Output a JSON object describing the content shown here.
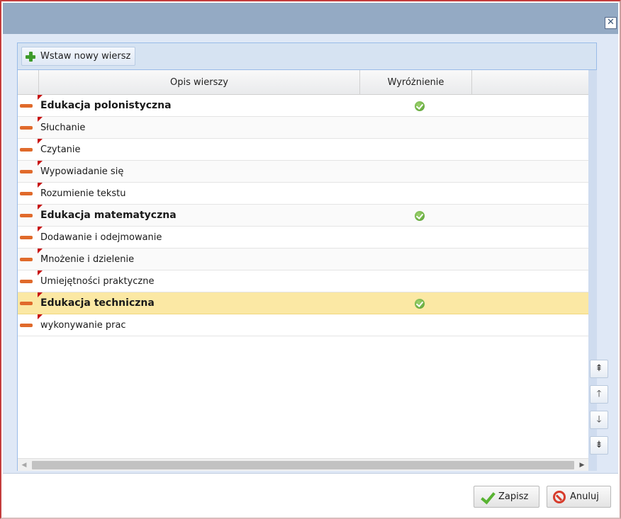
{
  "window": {
    "close_icon": "close-icon",
    "close_glyph": "✕"
  },
  "toolbar": {
    "add_row_label": "Wstaw nowy wiersz",
    "add_row_icon": "plus-icon"
  },
  "grid": {
    "columns": [
      "",
      "Opis wierszy",
      "Wyróżnienie"
    ],
    "rows": [
      {
        "label": "Edukacja polonistyczna",
        "bold": true,
        "highlighted": true,
        "selected": false
      },
      {
        "label": "Słuchanie",
        "bold": false,
        "highlighted": false,
        "selected": false
      },
      {
        "label": "Czytanie",
        "bold": false,
        "highlighted": false,
        "selected": false
      },
      {
        "label": "Wypowiadanie się",
        "bold": false,
        "highlighted": false,
        "selected": false
      },
      {
        "label": "Rozumienie tekstu",
        "bold": false,
        "highlighted": false,
        "selected": false
      },
      {
        "label": "Edukacja matematyczna",
        "bold": true,
        "highlighted": true,
        "selected": false
      },
      {
        "label": "Dodawanie i odejmowanie",
        "bold": false,
        "highlighted": false,
        "selected": false
      },
      {
        "label": "Mnożenie i dzielenie",
        "bold": false,
        "highlighted": false,
        "selected": false
      },
      {
        "label": "Umiejętności praktyczne",
        "bold": false,
        "highlighted": false,
        "selected": false
      },
      {
        "label": "Edukacja techniczna",
        "bold": true,
        "highlighted": true,
        "selected": true
      },
      {
        "label": "wykonywanie prac",
        "bold": false,
        "highlighted": false,
        "selected": false
      }
    ]
  },
  "move_buttons": [
    {
      "name": "move-top-button",
      "icon": "double-arrow-up-icon",
      "glyph": "⇞"
    },
    {
      "name": "move-up-button",
      "icon": "arrow-up-icon",
      "glyph": "🡑"
    },
    {
      "name": "move-down-button",
      "icon": "arrow-down-icon",
      "glyph": "🡓"
    },
    {
      "name": "move-bottom-button",
      "icon": "double-arrow-down-icon",
      "glyph": "⇟"
    }
  ],
  "footer": {
    "save_label": "Zapisz",
    "cancel_label": "Anuluj"
  },
  "colors": {
    "titlebar": "#94aac4",
    "selected_row": "#fbe8a4",
    "remove_icon": "#e06a2b",
    "check_icon": "#4f9a2c"
  }
}
